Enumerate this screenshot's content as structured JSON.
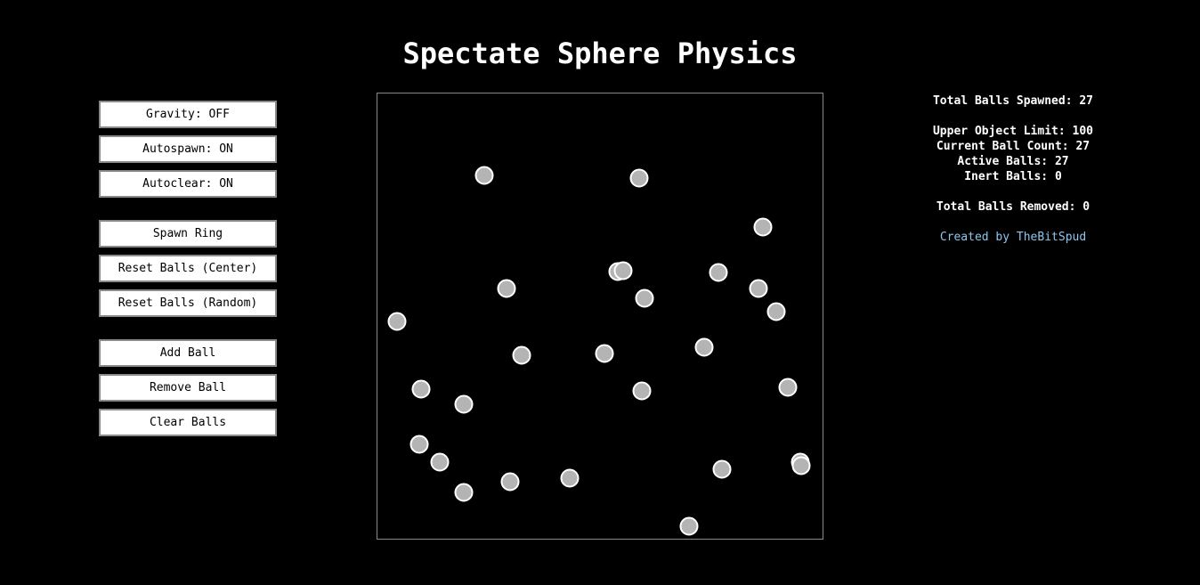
{
  "page": {
    "title": "Spectate Sphere Physics"
  },
  "controls": {
    "gravity_label": "Gravity: OFF",
    "autospawn_label": "Autospawn: ON",
    "autoclear_label": "Autoclear: ON",
    "spawn_ring_label": "Spawn Ring",
    "reset_center_label": "Reset Balls (Center)",
    "reset_random_label": "Reset Balls (Random)",
    "add_ball_label": "Add Ball",
    "remove_ball_label": "Remove Ball",
    "clear_balls_label": "Clear Balls"
  },
  "stats": {
    "total_spawned": "Total Balls Spawned: 27",
    "upper_limit": "Upper Object Limit: 100",
    "current_count": "Current Ball Count: 27",
    "active": "Active Balls: 27",
    "inert": "Inert Balls: 0",
    "total_removed": "Total Balls Removed: 0",
    "credit_prefix": "Created by ",
    "credit_name": "TheBitSpud"
  },
  "colors": {
    "background": "#000000",
    "ball_fill": "#b4b4b4",
    "ball_stroke": "#ffffff",
    "arena_border": "#8a8a8a",
    "credit_link": "#8ec7ee"
  }
}
